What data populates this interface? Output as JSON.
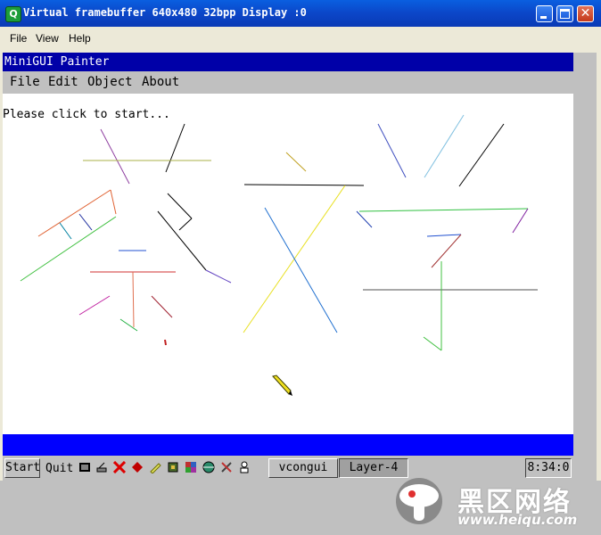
{
  "window": {
    "title": "Virtual framebuffer 640x480 32bpp Display :0",
    "icon_letter": "Q",
    "controls": [
      "minimize-icon",
      "maximize-icon",
      "close-icon"
    ]
  },
  "menubar": {
    "items": [
      "File",
      "View",
      "Help"
    ]
  },
  "minigui": {
    "title": "MiniGUI Painter",
    "menu": [
      "File",
      "Edit",
      "Object",
      "About"
    ],
    "prompt": "Please click to start...",
    "title_color": "#0000a8",
    "status_bar_color": "#0000fe"
  },
  "taskbar": {
    "start_label": "Start",
    "quit_label": "Quit",
    "icons": [
      "terminal-icon",
      "network-icon",
      "x-icon",
      "red-gem-icon",
      "pencil-icon",
      "cpu-icon",
      "palette-icon",
      "globe-icon",
      "tools-icon",
      "chess-icon"
    ],
    "tasks": [
      {
        "label": "vcongui",
        "pressed": false
      },
      {
        "label": "Layer-4",
        "pressed": true
      }
    ],
    "clock": "8:34:0"
  },
  "watermark": {
    "text": "黑区网络",
    "url": "www.heiqu.com"
  }
}
